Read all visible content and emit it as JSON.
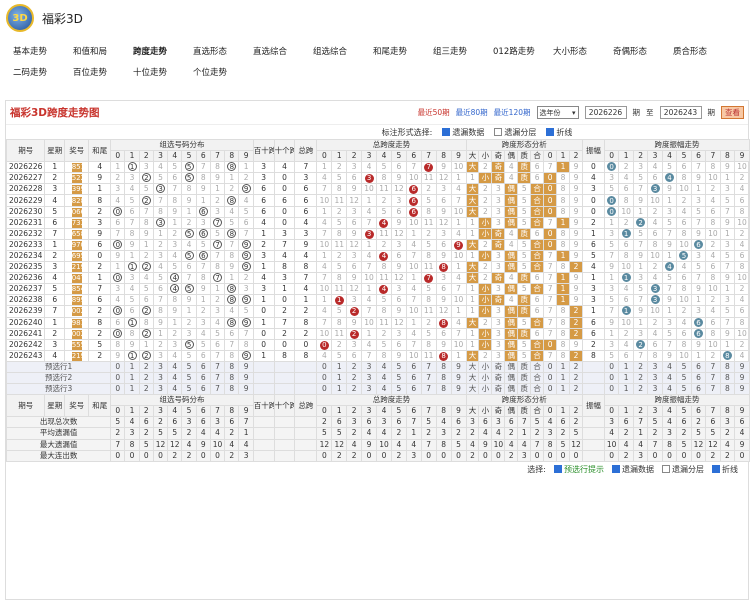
{
  "app": {
    "title": "福彩3D",
    "logo_text": "3D"
  },
  "nav": [
    "基本走势",
    "和值和局",
    "跨度走势",
    "直选形态",
    "直选综合",
    "组选综合",
    "和尾走势",
    "组三走势",
    "012路走势",
    "大小形态",
    "奇偶形态",
    "质合形态",
    "二码走势",
    "百位走势",
    "十位走势",
    "个位走势"
  ],
  "nav_active": 2,
  "panel": {
    "title": "福彩3D跨度走势图",
    "range_links": [
      "最近50期",
      "最近80期",
      "最近120期"
    ],
    "active_range": 0,
    "select": "选年份",
    "from": "2026226",
    "from_label": "期",
    "to_label": "至",
    "to": "2026243",
    "to_unit": "期",
    "query_btn": "查看"
  },
  "options": {
    "label": "标注形式选择:",
    "items": [
      {
        "label": "遗漏数据",
        "checked": true
      },
      {
        "label": "遗漏分层",
        "checked": false
      },
      {
        "label": "折线",
        "checked": true
      }
    ]
  },
  "head": {
    "qihao": "期号",
    "week": "星期",
    "prize": "奖号",
    "sum": "和尾",
    "group_dist": "组选号码分布",
    "hundred_ten": "百十跨",
    "ten_one": "十个跨",
    "total_span": "总跨",
    "total_trend": "总跨度走势",
    "shape": "跨度形态分析",
    "amp": "振幅",
    "amp_trend": "跨度振幅走势",
    "shape_cols": [
      "大",
      "小",
      "奇",
      "偶",
      "质",
      "合",
      "0",
      "1",
      "2"
    ]
  },
  "rows": [
    {
      "q": "2026226",
      "w": "1",
      "p": "851",
      "h": "4"
    },
    {
      "q": "2026227",
      "w": "2",
      "p": "522",
      "h": "9"
    },
    {
      "q": "2026228",
      "w": "3",
      "p": "399",
      "h": "1"
    },
    {
      "q": "2026229",
      "w": "4",
      "p": "828",
      "h": "8"
    },
    {
      "q": "2026230",
      "w": "5",
      "p": "066",
      "h": "2"
    },
    {
      "q": "2026231",
      "w": "6",
      "p": "733",
      "h": "3"
    },
    {
      "q": "2026232",
      "w": "7",
      "p": "658",
      "h": "9"
    },
    {
      "q": "2026233",
      "w": "1",
      "p": "970",
      "h": "6"
    },
    {
      "q": "2026234",
      "w": "2",
      "p": "695",
      "h": "0"
    },
    {
      "q": "2026235",
      "w": "3",
      "p": "219",
      "h": "2"
    },
    {
      "q": "2026236",
      "w": "4",
      "p": "047",
      "h": "1"
    },
    {
      "q": "2026237",
      "w": "5",
      "p": "854",
      "h": "7"
    },
    {
      "q": "2026238",
      "w": "6",
      "p": "899",
      "h": "6"
    },
    {
      "q": "2026239",
      "w": "7",
      "p": "002",
      "h": "2"
    },
    {
      "q": "2026240",
      "w": "1",
      "p": "981",
      "h": "8"
    },
    {
      "q": "2026241",
      "w": "2",
      "p": "002",
      "h": "2"
    },
    {
      "q": "2026242",
      "w": "3",
      "p": "555",
      "h": "5"
    },
    {
      "q": "2026243",
      "w": "4",
      "p": "219",
      "h": "2"
    }
  ],
  "pre_rows": [
    "预选行1",
    "预选行2",
    "预选行3"
  ],
  "stats": [
    {
      "label": "出现总次数",
      "vals": "5 4 6 2 6 3 6 3 6 7"
    },
    {
      "label": "平均遗漏值",
      "vals": "2 3 2 5 5 2 4 4 2 1"
    },
    {
      "label": "最大遗漏值",
      "vals": "7 8 5 12 12 4 9 10 4 4"
    },
    {
      "label": "最大连出数",
      "vals": "0 0 0 0 2 2 0 0 2 3"
    }
  ],
  "bottom": {
    "label": "选择:",
    "items": [
      {
        "label": "预选行提示",
        "checked": true
      },
      {
        "label": "遗漏数据",
        "checked": true
      },
      {
        "label": "遗漏分层",
        "checked": false
      },
      {
        "label": "折线",
        "checked": true
      }
    ]
  }
}
